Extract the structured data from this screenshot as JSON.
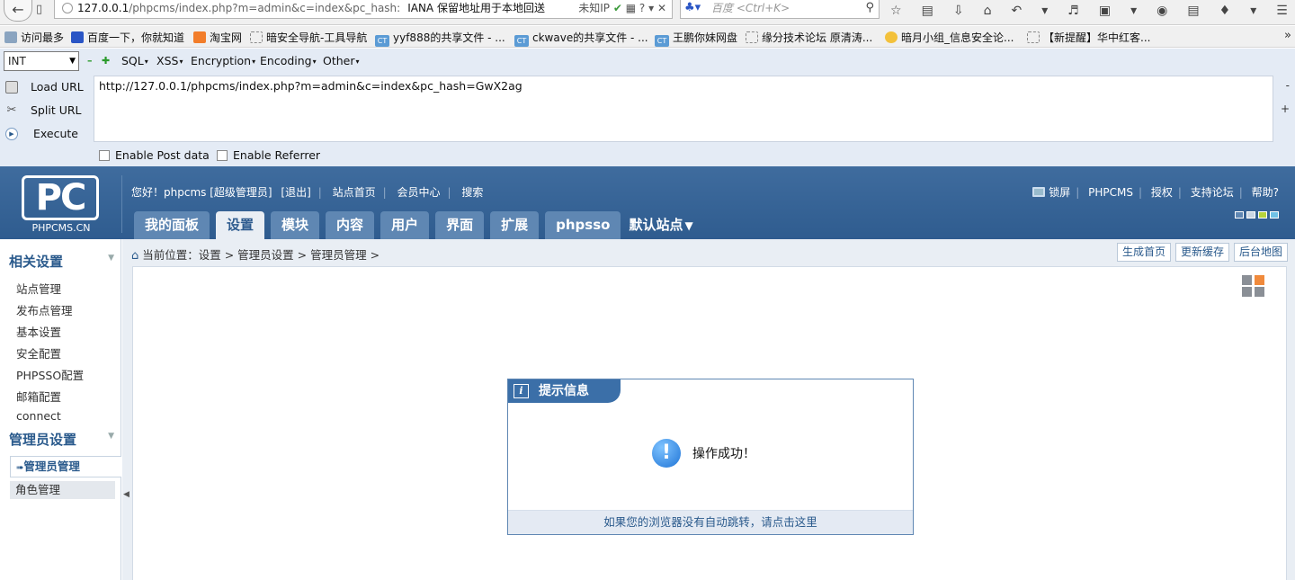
{
  "browser": {
    "url_host": "127.0.0.1",
    "url_path": "/phpcms/index.php?m=admin&c=index&pc_hash:",
    "url_note": "IANA 保留地址用于本地回送",
    "url_tail": "未知IP",
    "search_placeholder": "百度 <Ctrl+K>"
  },
  "bookmarks": [
    {
      "label": "访问最多",
      "icon": "gear-icon"
    },
    {
      "label": "百度一下，你就知道",
      "icon": "paw-icon"
    },
    {
      "label": "淘宝网",
      "icon": "taobao-icon"
    },
    {
      "label": "暗安全导航-工具导航",
      "icon": "folder-icon"
    },
    {
      "label": "yyf888的共享文件 - ...",
      "icon": "ct-icon"
    },
    {
      "label": "ckwave的共享文件 - ...",
      "icon": "ct-icon"
    },
    {
      "label": "王鹏你妹网盘",
      "icon": "ct-icon"
    },
    {
      "label": "缘分技术论坛 原清涛...",
      "icon": "folder-icon"
    },
    {
      "label": "暗月小组_信息安全论...",
      "icon": "moon-icon"
    },
    {
      "label": "【新提醒】华中红客...",
      "icon": "folder-icon"
    }
  ],
  "hackbar": {
    "select_value": "INT",
    "menus": [
      "SQL",
      "XSS",
      "Encryption",
      "Encoding",
      "Other"
    ],
    "load_url": "Load URL",
    "split_url": "Split URL",
    "execute": "Execute",
    "url_value": "http://127.0.0.1/phpcms/index.php?m=admin&c=index&pc_hash=GwX2ag",
    "enable_post": "Enable Post data",
    "enable_referrer": "Enable Referrer"
  },
  "header": {
    "logo_text": "PHPCMS.CN",
    "greeting": "您好！phpcms [超级管理员]",
    "links": [
      "[退出]",
      "站点首页",
      "会员中心",
      "搜索"
    ],
    "right_links": [
      "锁屏",
      "PHPCMS",
      "授权",
      "支持论坛",
      "帮助?"
    ],
    "tabs": [
      "我的面板",
      "设置",
      "模块",
      "内容",
      "用户",
      "界面",
      "扩展",
      "phpsso"
    ],
    "active_tab": "设置",
    "site_tab": "默认站点",
    "swatch_colors": [
      "#ffffff",
      "#c9d6e3",
      "#b6d33c",
      "#6fc1e6"
    ]
  },
  "sidebar": {
    "groups": [
      {
        "title": "相关设置",
        "items": [
          "站点管理",
          "发布点管理",
          "基本设置",
          "安全配置",
          "PHPSSO配置",
          "邮箱配置",
          "connect"
        ]
      },
      {
        "title": "管理员设置",
        "items": [
          "管理员管理",
          "角色管理"
        ]
      }
    ],
    "active_item": "管理员管理"
  },
  "content": {
    "breadcrumb": "当前位置：设置 > 管理员设置 > 管理员管理 >",
    "buttons": [
      "生成首页",
      "更新缓存",
      "后台地图"
    ]
  },
  "message": {
    "title": "提示信息",
    "text": "操作成功！",
    "footer": "如果您的浏览器没有自动跳转，请点击这里"
  }
}
